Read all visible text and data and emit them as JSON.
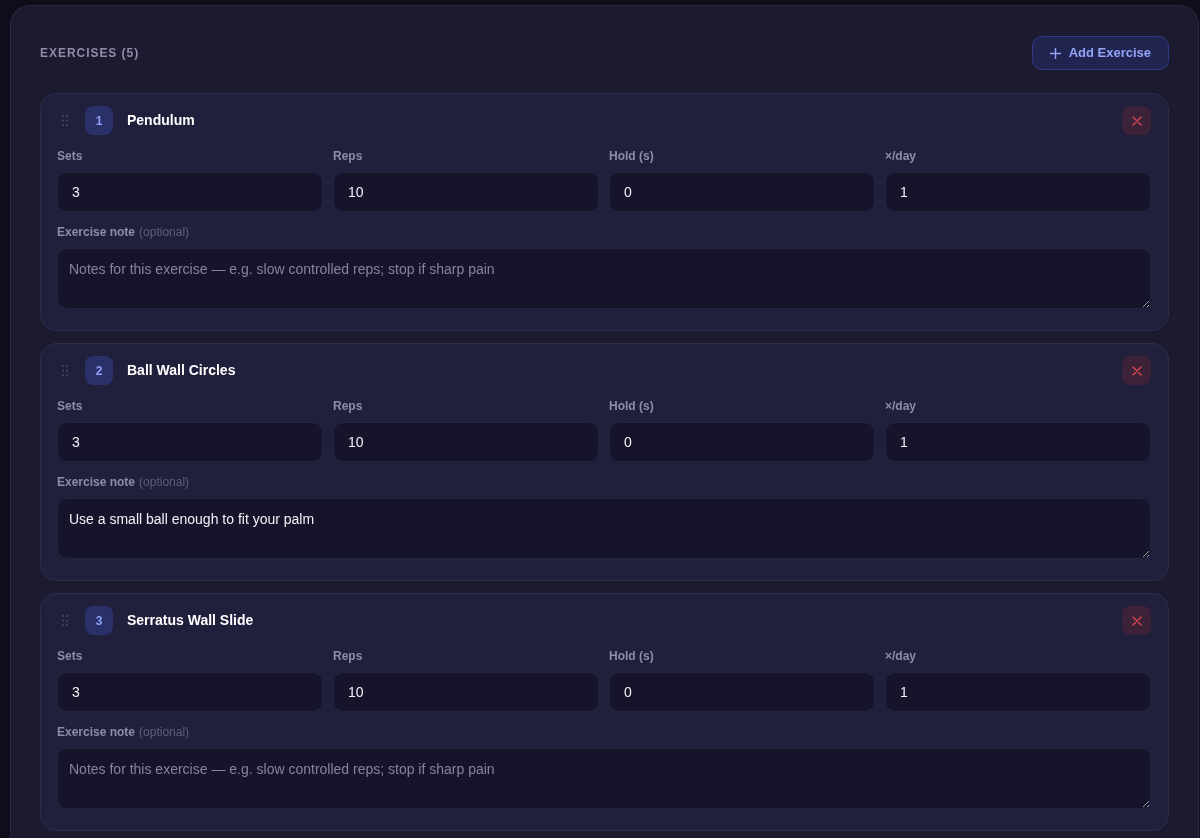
{
  "header": {
    "title": "EXERCISES (5)",
    "add_button": {
      "label": "Add Exercise"
    }
  },
  "exercises": [
    {
      "number": "1",
      "name": "Pendulum",
      "fields": [
        {
          "label": "Sets",
          "value": "3"
        },
        {
          "label": "Reps",
          "value": "10"
        },
        {
          "label": "Hold (s)",
          "value": "0"
        },
        {
          "label": "×/day",
          "value": "1"
        }
      ],
      "note": {
        "label": "Exercise note",
        "hint": "(optional)",
        "placeholder": "Notes for this exercise — e.g. slow controlled reps; stop if sharp pain"
      }
    },
    {
      "number": "2",
      "name": "Ball Wall Circles",
      "fields": [
        {
          "label": "Sets",
          "value": "3"
        },
        {
          "label": "Reps",
          "value": "10"
        },
        {
          "label": "Hold (s)",
          "value": "0"
        },
        {
          "label": "×/day",
          "value": "1"
        }
      ],
      "note": {
        "label": "Exercise note",
        "hint": "(optional)",
        "value": "Use a small ball enough to fit your palm"
      }
    },
    {
      "number": "3",
      "name": "Serratus Wall Slide",
      "fields": [
        {
          "label": "Sets",
          "value": "3"
        },
        {
          "label": "Reps",
          "value": "10"
        },
        {
          "label": "Hold (s)",
          "value": "0"
        },
        {
          "label": "×/day",
          "value": "1"
        }
      ],
      "note": {
        "label": "Exercise note",
        "hint": "(optional)",
        "placeholder": "Notes for this exercise — e.g. slow controlled reps; stop if sharp pain"
      }
    }
  ]
}
